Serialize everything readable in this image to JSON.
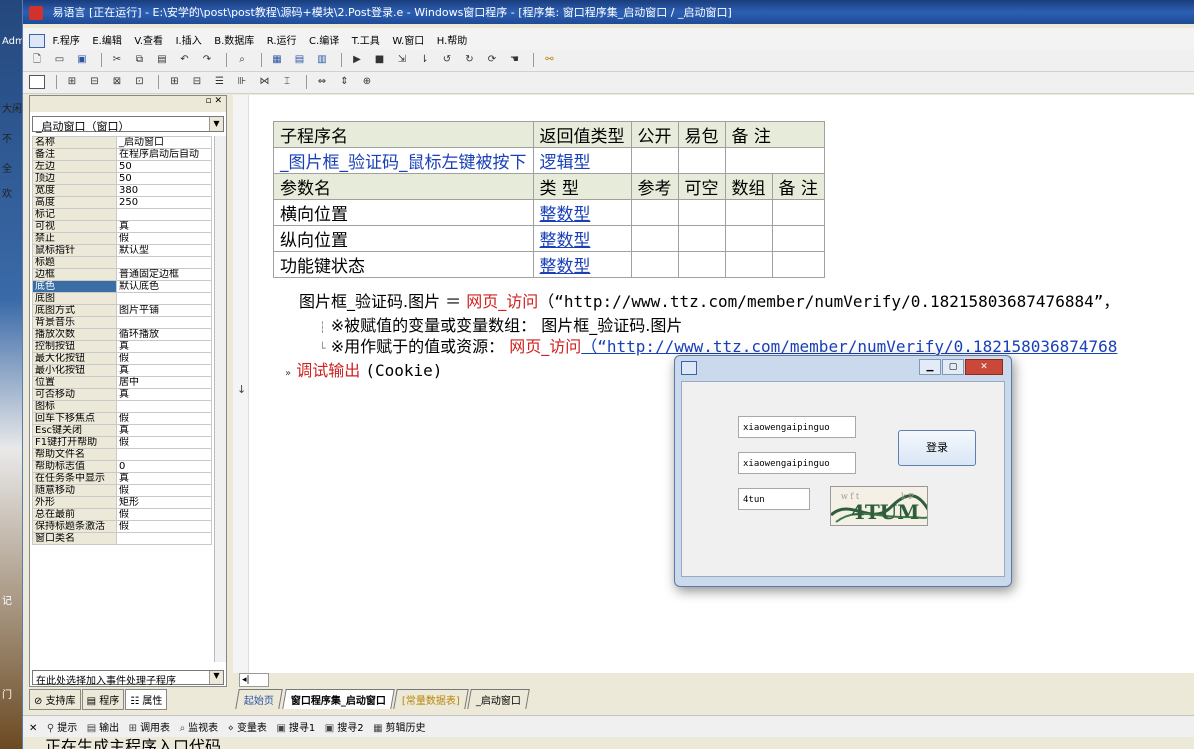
{
  "window": {
    "title": "易语言 [正在运行] - E:\\安学的\\post\\post教程\\源码+模块\\2.Post登录.e - Windows窗口程序 - [程序集: 窗口程序集_启动窗口 / _启动窗口]"
  },
  "desktop": {
    "labels": [
      "Admi",
      "大闲",
      "不",
      "全",
      "欢",
      "记",
      "门"
    ]
  },
  "menu": [
    "F.程序",
    "E.编辑",
    "V.查看",
    "I.插入",
    "B.数据库",
    "R.运行",
    "C.编译",
    "T.工具",
    "W.窗口",
    "H.帮助"
  ],
  "properties": {
    "selector": "_启动窗口（窗口）",
    "rows": [
      {
        "name": "名称",
        "value": "_启动窗口"
      },
      {
        "name": "备注",
        "value": "在程序启动后自动"
      },
      {
        "name": "左边",
        "value": "50"
      },
      {
        "name": "顶边",
        "value": "50"
      },
      {
        "name": "宽度",
        "value": "380"
      },
      {
        "name": "高度",
        "value": "250"
      },
      {
        "name": "标记",
        "value": ""
      },
      {
        "name": "可视",
        "value": "真"
      },
      {
        "name": "禁止",
        "value": "假"
      },
      {
        "name": "鼠标指针",
        "value": "默认型"
      },
      {
        "name": "标题",
        "value": ""
      },
      {
        "name": "边框",
        "value": "普通固定边框"
      },
      {
        "name": "底色",
        "value": "默认底色"
      },
      {
        "name": "底图",
        "value": ""
      },
      {
        "name": "底图方式",
        "value": "图片平铺"
      },
      {
        "name": "背景音乐",
        "value": ""
      },
      {
        "name": "播放次数",
        "value": "循环播放"
      },
      {
        "name": "控制按钮",
        "value": "真"
      },
      {
        "name": "最大化按钮",
        "value": "假"
      },
      {
        "name": "最小化按钮",
        "value": "真"
      },
      {
        "name": "位置",
        "value": "居中"
      },
      {
        "name": "可否移动",
        "value": "真"
      },
      {
        "name": "图标",
        "value": ""
      },
      {
        "name": "回车下移焦点",
        "value": "假"
      },
      {
        "name": "Esc键关闭",
        "value": "真"
      },
      {
        "name": "F1键打开帮助",
        "value": "假"
      },
      {
        "name": "帮助文件名",
        "value": ""
      },
      {
        "name": "帮助标志值",
        "value": "0"
      },
      {
        "name": "在任务条中显示",
        "value": "真"
      },
      {
        "name": "随意移动",
        "value": "假"
      },
      {
        "name": "外形",
        "value": "矩形"
      },
      {
        "name": "总在最前",
        "value": "假"
      },
      {
        "name": "保持标题条激活",
        "value": "假"
      },
      {
        "name": "窗口类名",
        "value": ""
      }
    ],
    "event_selector": "在此处选择加入事件处理子程序",
    "tabs": [
      "支持库",
      "程序",
      "属性"
    ]
  },
  "editor": {
    "sub_header": [
      "子程序名",
      "返回值类型",
      "公开",
      "易包",
      "备 注"
    ],
    "sub_row": [
      "_图片框_验证码_鼠标左键被按下",
      "逻辑型",
      "",
      "",
      ""
    ],
    "param_header": [
      "参数名",
      "类 型",
      "参考",
      "可空",
      "数组",
      "备 注"
    ],
    "params": [
      {
        "name": "横向位置",
        "type": "整数型"
      },
      {
        "name": "纵向位置",
        "type": "整数型"
      },
      {
        "name": "功能键状态",
        "type": "整数型"
      }
    ],
    "line1_var": "图片框_验证码.图片 ＝ ",
    "line1_func": "网页_访问",
    "line1_args": "（“http://www.ttz.com/member/numVerify/0.18215803687476884”，",
    "line2_label": "※被赋值的变量或变量数组：",
    "line2_value": "图片框_验证码.图片",
    "line3_label": "※用作赋于的值或资源：",
    "line3_func": "网页_访问",
    "line3_args": "（“http://www.ttz.com/member/numVerify/0.182158036874768",
    "line4_func": "调试输出",
    "line4_args": "(Cookie)"
  },
  "popup": {
    "username": "xiaowengaipinguo",
    "password": "xiaowengaipinguo",
    "captcha_input": "4tun",
    "captcha_text": "4TUM",
    "login_label": "登录"
  },
  "doc_tabs": [
    "起始页",
    "窗口程序集_启动窗口",
    "[常量数据表]",
    "_启动窗口"
  ],
  "bottom_toolbar": [
    "提示",
    "输出",
    "调用表",
    "监视表",
    "变量表",
    "搜寻1",
    "搜寻2",
    "剪辑历史"
  ],
  "status": "正在生成主程序入口代码"
}
